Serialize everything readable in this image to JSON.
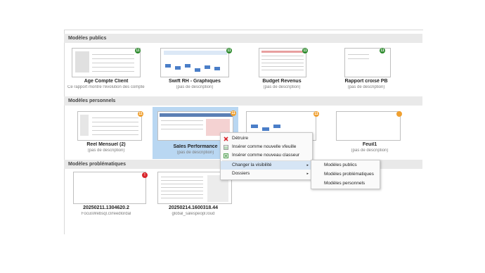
{
  "sections": {
    "public": "Modèles publics",
    "personal": "Modèles personnels",
    "problematic": "Modèles problématiques"
  },
  "public_cards": [
    {
      "title": "Age Compte Client",
      "desc": "Ce rapport montre l'évolution des compte ...",
      "badge": "11"
    },
    {
      "title": "Swift RH - Graphiques",
      "desc": "(pas de description)",
      "badge": "11"
    },
    {
      "title": "Budget Revenus",
      "desc": "(pas de description)",
      "badge": "11"
    },
    {
      "title": "Rapport croisé PB",
      "desc": "(pas de description)",
      "badge": "11"
    }
  ],
  "personal_cards": [
    {
      "title": "Reel Mensuel (2)",
      "desc": "(pas de description)",
      "badge": "11"
    },
    {
      "title": "Sales Performance",
      "desc": "(pas de description)",
      "badge": "11"
    },
    {
      "title": "",
      "desc": "",
      "badge": "11"
    },
    {
      "title": "Feuil1",
      "desc": "(pas de description)",
      "badge": ""
    }
  ],
  "problem_cards": [
    {
      "title": "20250211.1304620.2",
      "desc": "FocusWebsql.cl/reedlordal",
      "badge": "!"
    },
    {
      "title": "20250214.1600318.44",
      "desc": "global_salespeopl.loud",
      "badge": ""
    }
  ],
  "context_menu": {
    "items": [
      {
        "label": "Détruire",
        "icon": "delete-icon"
      },
      {
        "label": "Insérer comme nouvelle vfeuille",
        "icon": "sheet-icon"
      },
      {
        "label": "Insérer comme nouveau classeur",
        "icon": "workbook-icon"
      },
      {
        "label": "Changer la visibilité",
        "arrow": "▸"
      },
      {
        "label": "Dossiers",
        "arrow": "▸"
      }
    ]
  },
  "submenu": {
    "items": [
      "Modèles publics",
      "Modèles problématiques",
      "Modèles personnels"
    ]
  },
  "colors": {
    "selection": "#b9d7f2",
    "highlight": "#d6e5f5",
    "green": "#2e8b2e",
    "orange": "#f0a030",
    "red": "#d9262c"
  }
}
